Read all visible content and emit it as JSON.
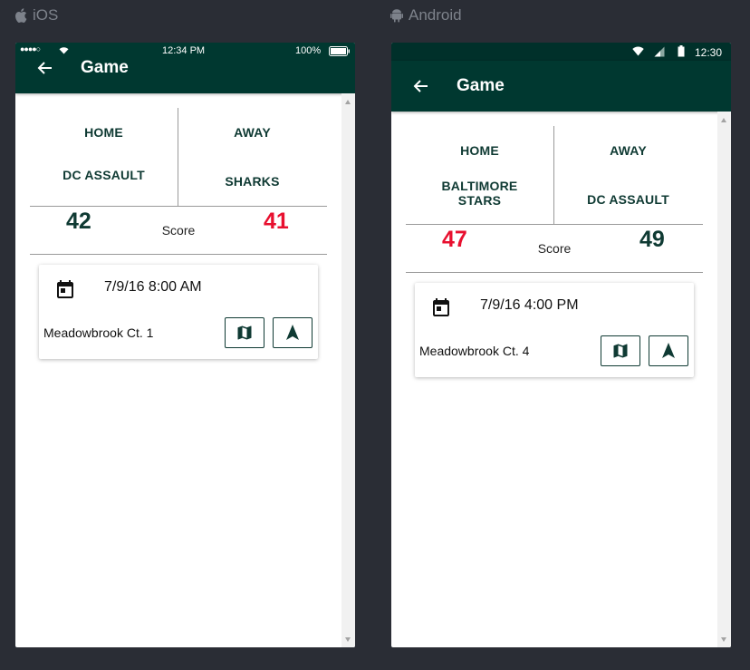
{
  "platforms": {
    "ios": {
      "label": "iOS"
    },
    "android": {
      "label": "Android"
    }
  },
  "ios": {
    "status": {
      "carrier_dots": "●●●●○",
      "time": "12:34 PM",
      "battery": "100%"
    },
    "header": {
      "title": "Game"
    },
    "teams": {
      "home_label": "HOME",
      "away_label": "AWAY",
      "home_name": "DC ASSAULT",
      "away_name": "SHARKS"
    },
    "score": {
      "home": "42",
      "away": "41",
      "label": "Score",
      "home_color": "#0f3a33",
      "away_color": "#e8102f"
    },
    "card": {
      "datetime": "7/9/16 8:00 AM",
      "location": "Meadowbrook Ct. 1"
    }
  },
  "android": {
    "status": {
      "time": "12:30"
    },
    "header": {
      "title": "Game"
    },
    "teams": {
      "home_label": "HOME",
      "away_label": "AWAY",
      "home_name_line1": "BALTIMORE",
      "home_name_line2": "STARS",
      "away_name": "DC ASSAULT"
    },
    "score": {
      "home": "47",
      "away": "49",
      "label": "Score",
      "home_color": "#e8102f",
      "away_color": "#0f3a33"
    },
    "card": {
      "datetime": "7/9/16 4:00 PM",
      "location": "Meadowbrook Ct. 4"
    }
  },
  "colors": {
    "header": "#003830",
    "accent_red": "#e8102f",
    "dark_green": "#0f3a33"
  },
  "icons": [
    "apple-icon",
    "android-icon",
    "back-arrow-icon",
    "calendar-icon",
    "map-icon",
    "navigation-icon",
    "wifi-icon",
    "signal-icon",
    "battery-icon"
  ]
}
